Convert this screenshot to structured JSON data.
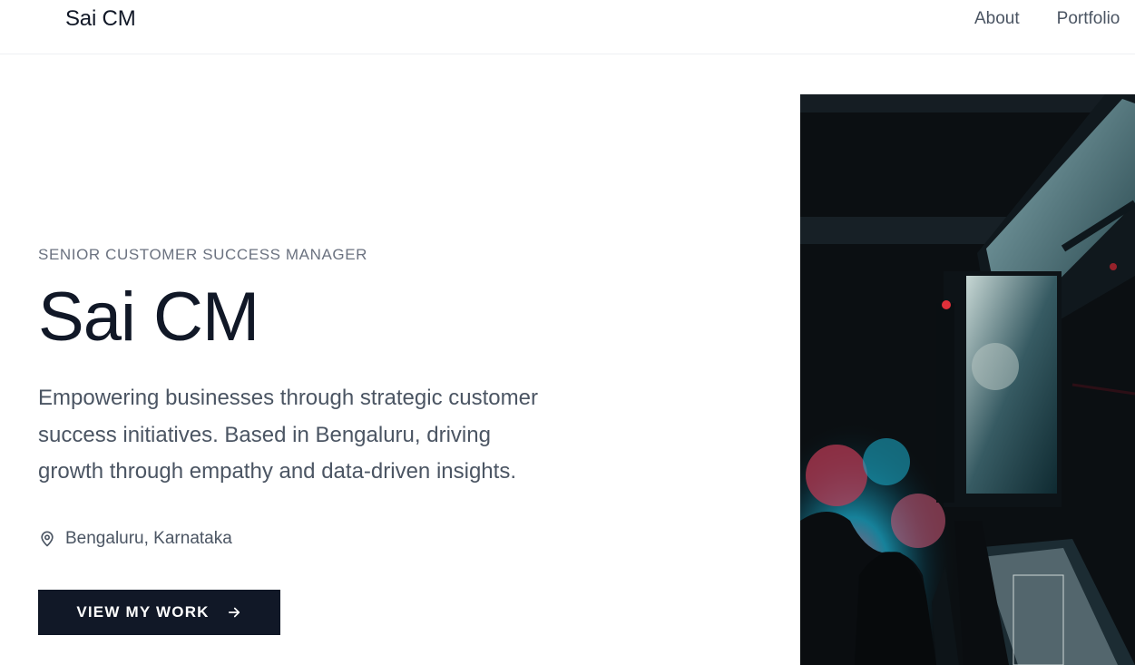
{
  "header": {
    "brand": "Sai CM",
    "nav": [
      {
        "label": "About"
      },
      {
        "label": "Portfolio"
      }
    ]
  },
  "hero": {
    "eyebrow": "SENIOR CUSTOMER SUCCESS MANAGER",
    "title": "Sai CM",
    "description_lines": [
      "Empowering businesses through strategic customer",
      "success initiatives. Based in Bengaluru, driving",
      "growth through empathy and data-driven insights."
    ],
    "location": "Bengaluru, Karnataka",
    "location_icon": "map-pin-icon",
    "cta_label": "VIEW MY WORK",
    "cta_icon": "arrow-right-icon"
  },
  "colors": {
    "text_dark": "#111827",
    "text_muted": "#4b5563",
    "eyebrow": "#6b7280",
    "button_bg": "#111827",
    "button_text": "#ffffff"
  }
}
